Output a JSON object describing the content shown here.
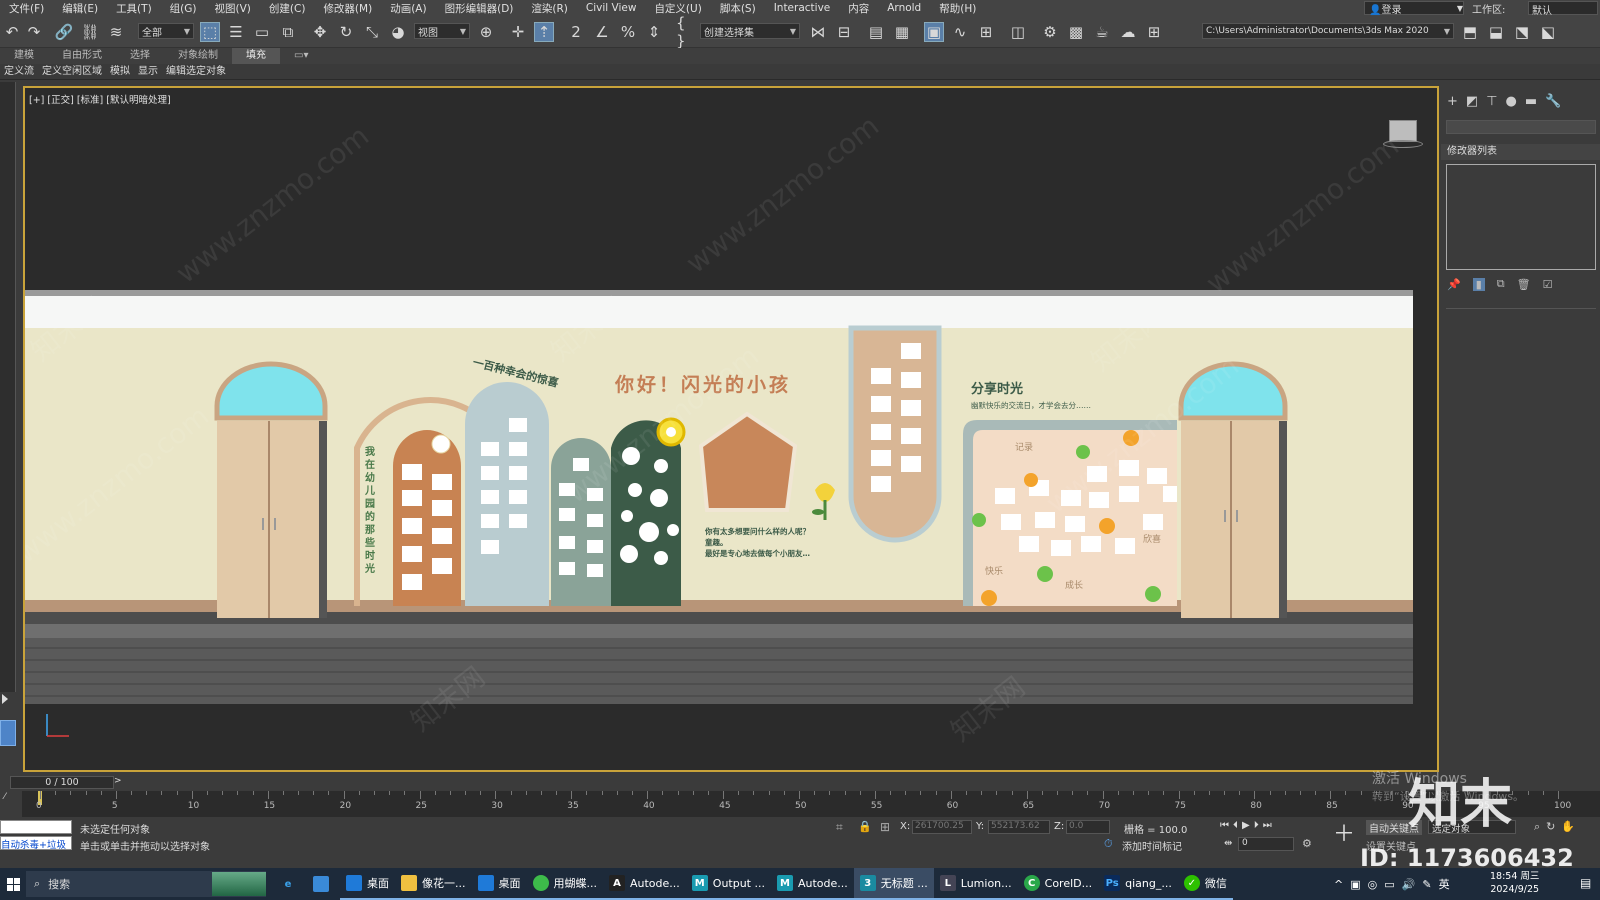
{
  "menu": [
    "文件(F)",
    "编辑(E)",
    "工具(T)",
    "组(G)",
    "视图(V)",
    "创建(C)",
    "修改器(M)",
    "动画(A)",
    "图形编辑器(D)",
    "渲染(R)",
    "Civil View",
    "自定义(U)",
    "脚本(S)",
    "Interactive",
    "内容",
    "Arnold",
    "帮助(H)"
  ],
  "login": "登录",
  "workspace_label": "工作区:",
  "workspace_value": "默认",
  "toolbar": {
    "filter_select": "全部",
    "ref_coord": "视图",
    "named_selection": "创建选择集",
    "project_path": "C:\\Users\\Administrator\\Documents\\3ds Max 2020"
  },
  "ribbon_tabs": [
    "建模",
    "自由形式",
    "选择",
    "对象绘制",
    "填充"
  ],
  "ribbon_selected": "填充",
  "subribbon": [
    "定义流",
    "定义空闲区域",
    "模拟",
    "显示",
    "编辑选定对象"
  ],
  "viewport": {
    "label": "[+] [正交] [标准] [默认明暗处理]",
    "scene": {
      "title": "你好！闪光的小孩",
      "arc_text": "一百种幸会的惊喜",
      "vertical_text": "我在幼儿园的那些时光",
      "share_title": "分享时光",
      "share_sub": "幽默快乐的交流日，才学会去分……",
      "question_lines": [
        "你有太多想要问什么样的人呢？",
        "童趣。",
        "最好是专心地去做每个小朋友…"
      ],
      "board_tags": [
        "记录",
        "欣喜",
        "快乐",
        "成长"
      ]
    }
  },
  "cmdpanel": {
    "modifier_list": "修改器列表"
  },
  "timeline": {
    "frame_display": "0 / 100",
    "ticks": [
      "0",
      "5",
      "10",
      "15",
      "20",
      "25",
      "30",
      "35",
      "40",
      "45",
      "50",
      "55",
      "60",
      "65",
      "70",
      "75",
      "80",
      "85",
      "90",
      "95",
      "100"
    ]
  },
  "status": {
    "script_label": "自动杀毒+垃圾",
    "line1": "未选定任何对象",
    "line2": "单击或单击并拖动以选择对象",
    "x_label": "X:",
    "x_value": "261700.25",
    "y_label": "Y:",
    "y_value": "552173.62",
    "z_label": "Z:",
    "z_value": "0.0",
    "grid": "栅格 = 100.0",
    "add_time_tag": "添加时间标记",
    "autokey": "自动关键点",
    "selected_obj": "选定对象",
    "set_key": "设置关键点",
    "frame_value": "0"
  },
  "activate": {
    "line1": "激活 Windows",
    "line2": "转到“设置”以激活 Windows。"
  },
  "watermark": {
    "site": "www.znzmo.com",
    "brand": "知末网",
    "logo": "知末",
    "id_text": "ID: 1173606432"
  },
  "taskbar": {
    "search": "搜索",
    "items": [
      "桌面",
      "像花一...",
      "桌面",
      "用蝴蝶...",
      "Autode...",
      "Output ...",
      "Autode...",
      "无标题 ...",
      "Lumion...",
      "CorelD...",
      "qiang_...",
      "微信"
    ],
    "ime": "英",
    "time": "18:54 周三",
    "date": "2024/9/25"
  }
}
